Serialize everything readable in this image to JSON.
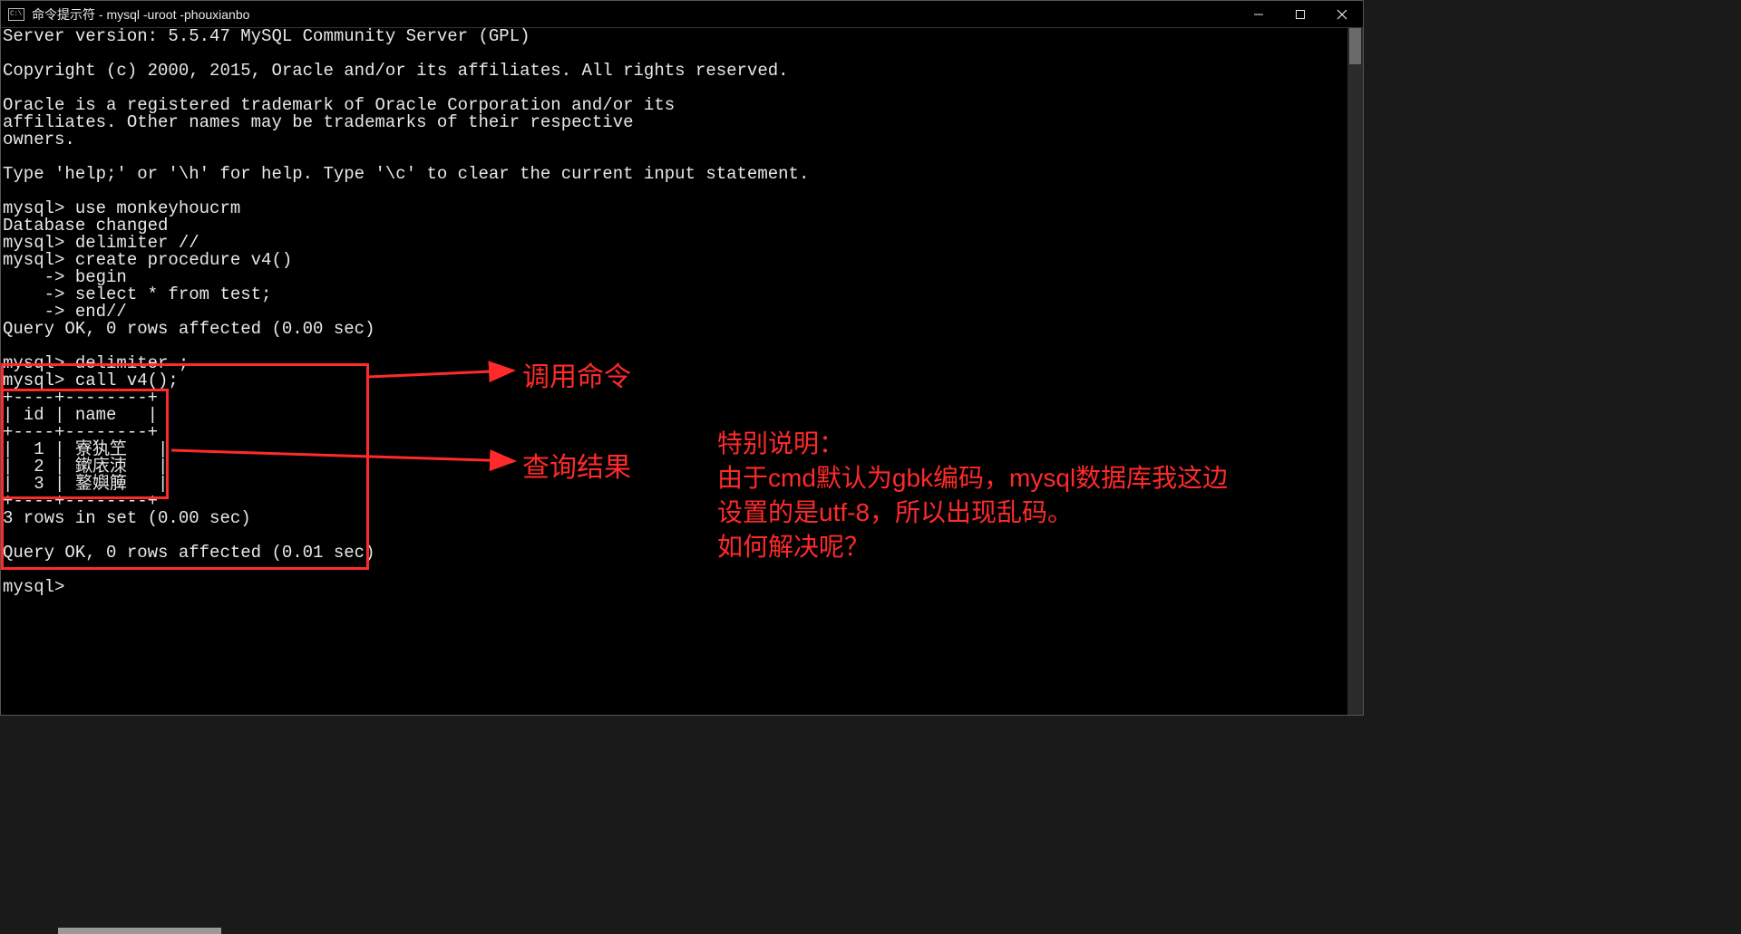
{
  "window": {
    "title": "命令提示符 - mysql  -uroot -phouxianbo",
    "icon_text": "C:\\"
  },
  "terminal": {
    "lines": [
      "Server version: 5.5.47 MySQL Community Server (GPL)",
      "",
      "Copyright (c) 2000, 2015, Oracle and/or its affiliates. All rights reserved.",
      "",
      "Oracle is a registered trademark of Oracle Corporation and/or its",
      "affiliates. Other names may be trademarks of their respective",
      "owners.",
      "",
      "Type 'help;' or '\\h' for help. Type '\\c' to clear the current input statement.",
      "",
      "mysql> use monkeyhoucrm",
      "Database changed",
      "mysql> delimiter //",
      "mysql> create procedure v4()",
      "    -> begin",
      "    -> select * from test;",
      "    -> end//",
      "Query OK, 0 rows affected (0.00 sec)",
      "",
      "mysql> delimiter ;",
      "mysql> call v4();",
      "+----+--------+",
      "| id | name   |",
      "+----+--------+",
      "|  1 | 寮犱笁   |",
      "|  2 | 鏉庡洓   |",
      "|  3 | 鐜嬩簲   |",
      "+----+--------+",
      "3 rows in set (0.00 sec)",
      "",
      "Query OK, 0 rows affected (0.01 sec)",
      "",
      "mysql>",
      ""
    ]
  },
  "annotations": {
    "label_call": "调用命令",
    "label_result": "查询结果",
    "explanation_l1": "特别说明：",
    "explanation_l2": "由于cmd默认为gbk编码，mysql数据库我这边",
    "explanation_l3": "设置的是utf-8，所以出现乱码。",
    "explanation_l4": "如何解决呢？"
  },
  "colors": {
    "red": "#ff2a2a",
    "terminal_fg": "#e8e8e8",
    "terminal_bg": "#000000"
  }
}
